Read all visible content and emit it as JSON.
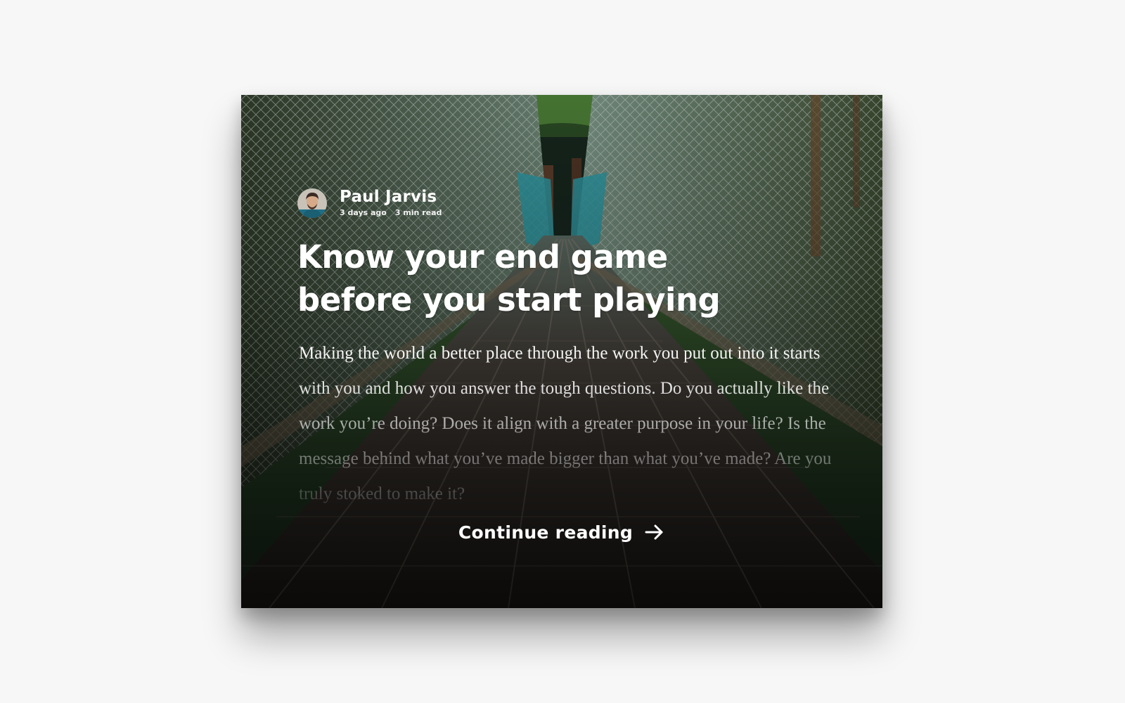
{
  "post": {
    "author": {
      "name": "Paul Jarvis",
      "posted": "3 days ago",
      "read_time": "3 min read"
    },
    "title": "Know your end game before you start playing",
    "excerpt": "Making the world a better place through the work you put out into it starts with you and how you answer the tough questions. Do you actually like the work you’re doing? Does it align with a greater purpose in your life? Is the message behind what you’ve made bigger than what you’ve made? Are you truly stoked to make it?",
    "continue_label": "Continue reading"
  },
  "icons": {
    "continue": "arrow-right-icon",
    "avatar": "avatar-portrait"
  }
}
